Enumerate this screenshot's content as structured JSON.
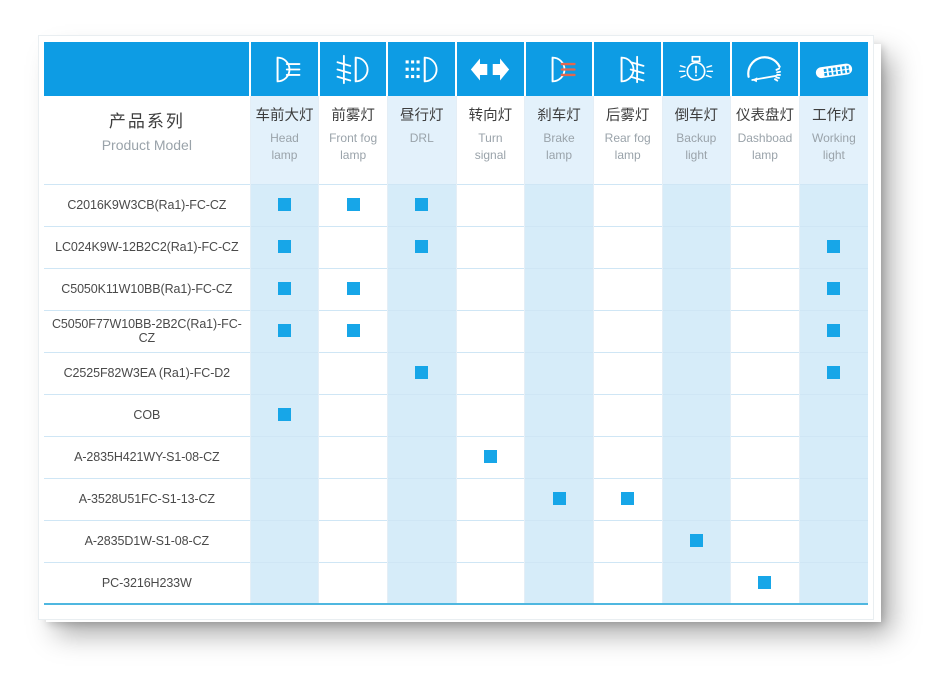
{
  "table": {
    "model_header": {
      "cn": "产品系列",
      "en": "Product Model"
    },
    "columns": [
      {
        "id": "head-lamp",
        "icon": "headlamp-icon",
        "cn": "车前大灯",
        "en_line1": "Head",
        "en_line2": "lamp"
      },
      {
        "id": "front-fog",
        "icon": "front-fog-icon",
        "cn": "前雾灯",
        "en_line1": "Front fog",
        "en_line2": "lamp"
      },
      {
        "id": "drl",
        "icon": "drl-icon",
        "cn": "昼行灯",
        "en_line1": "DRL",
        "en_line2": ""
      },
      {
        "id": "turn-signal",
        "icon": "turn-signal-icon",
        "cn": "转向灯",
        "en_line1": "Turn",
        "en_line2": "signal"
      },
      {
        "id": "brake-lamp",
        "icon": "brake-lamp-icon",
        "cn": "刹车灯",
        "en_line1": "Brake",
        "en_line2": "lamp"
      },
      {
        "id": "rear-fog",
        "icon": "rear-fog-icon",
        "cn": "后雾灯",
        "en_line1": "Rear fog",
        "en_line2": "lamp"
      },
      {
        "id": "backup-light",
        "icon": "backup-light-icon",
        "cn": "倒车灯",
        "en_line1": "Backup",
        "en_line2": "light"
      },
      {
        "id": "dashboard",
        "icon": "dashboard-icon",
        "cn": "仪表盘灯",
        "en_line1": "Dashboad",
        "en_line2": "lamp"
      },
      {
        "id": "working-light",
        "icon": "working-light-icon",
        "cn": "工作灯",
        "en_line1": "Working",
        "en_line2": "light"
      }
    ],
    "rows": [
      {
        "model": "C2016K9W3CB(Ra1)-FC-CZ",
        "marks": [
          1,
          1,
          1,
          0,
          0,
          0,
          0,
          0,
          0
        ]
      },
      {
        "model": "LC024K9W-12B2C2(Ra1)-FC-CZ",
        "marks": [
          1,
          0,
          1,
          0,
          0,
          0,
          0,
          0,
          1
        ]
      },
      {
        "model": "C5050K11W10BB(Ra1)-FC-CZ",
        "marks": [
          1,
          1,
          0,
          0,
          0,
          0,
          0,
          0,
          1
        ]
      },
      {
        "model": "C5050F77W10BB-2B2C(Ra1)-FC-CZ",
        "marks": [
          1,
          1,
          0,
          0,
          0,
          0,
          0,
          0,
          1
        ]
      },
      {
        "model": "C2525F82W3EA (Ra1)-FC-D2",
        "marks": [
          0,
          0,
          1,
          0,
          0,
          0,
          0,
          0,
          1
        ]
      },
      {
        "model": "COB",
        "marks": [
          1,
          0,
          0,
          0,
          0,
          0,
          0,
          0,
          0
        ]
      },
      {
        "model": "A-2835H421WY-S1-08-CZ",
        "marks": [
          0,
          0,
          0,
          1,
          0,
          0,
          0,
          0,
          0
        ]
      },
      {
        "model": "A-3528U51FC-S1-13-CZ",
        "marks": [
          0,
          0,
          0,
          0,
          1,
          1,
          0,
          0,
          0
        ]
      },
      {
        "model": "A-2835D1W-S1-08-CZ",
        "marks": [
          0,
          0,
          0,
          0,
          0,
          0,
          1,
          0,
          0
        ]
      },
      {
        "model": "PC-3216H233W",
        "marks": [
          0,
          0,
          0,
          0,
          0,
          0,
          0,
          1,
          0
        ]
      }
    ]
  },
  "colors": {
    "header_blue": "#0d9ce4",
    "mark_blue": "#17a6e8",
    "shaded_cell": "#d6ecf9",
    "shaded_header_cell": "#e3f1fb",
    "bottom_rule": "#4fb7e0",
    "brake_accent": "#e2674f"
  }
}
